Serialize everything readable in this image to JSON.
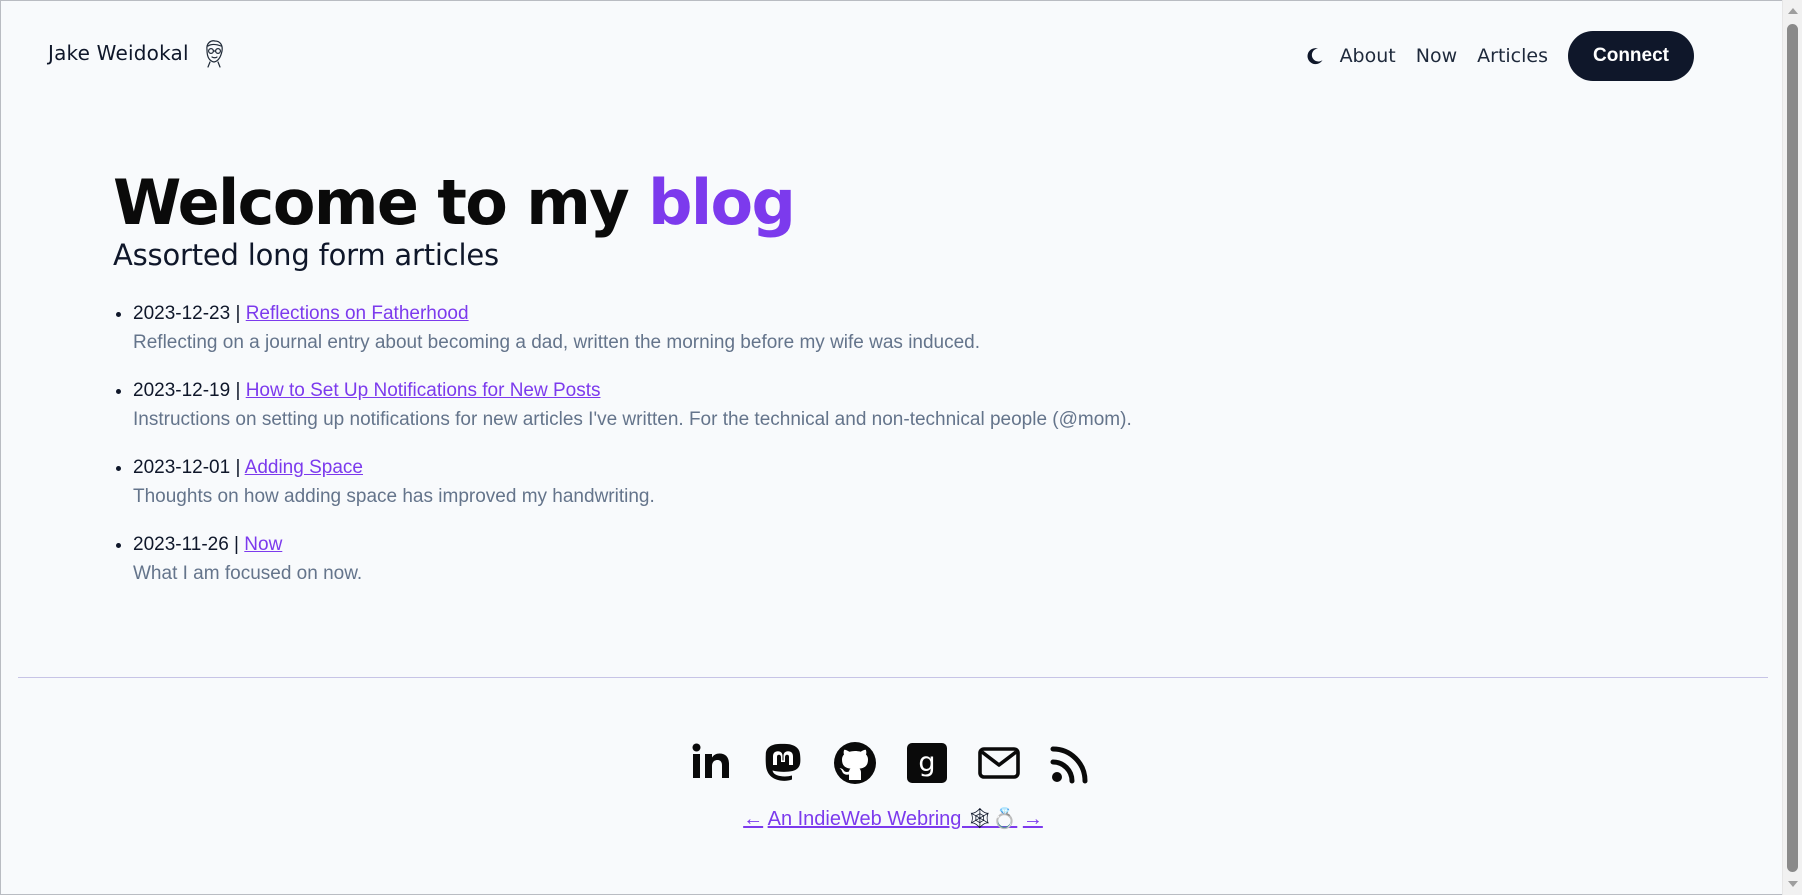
{
  "header": {
    "brand_name": "Jake Weidokal",
    "nav": {
      "about": "About",
      "now": "Now",
      "articles": "Articles",
      "connect": "Connect"
    }
  },
  "main": {
    "title_prefix": "Welcome to my ",
    "title_accent": "blog",
    "subtitle": "Assorted long form articles",
    "articles": [
      {
        "date": "2023-12-23",
        "separator": " | ",
        "title": "Reflections on Fatherhood",
        "description": "Reflecting on a journal entry about becoming a dad, written the morning before my wife was induced."
      },
      {
        "date": "2023-12-19",
        "separator": " | ",
        "title": "How to Set Up Notifications for New Posts",
        "description": "Instructions on setting up notifications for new articles I've written. For the technical and non-technical people (@mom)."
      },
      {
        "date": "2023-12-01",
        "separator": " | ",
        "title": "Adding Space",
        "description": "Thoughts on how adding space has improved my handwriting."
      },
      {
        "date": "2023-11-26",
        "separator": " | ",
        "title": "Now",
        "description": "What I am focused on now."
      }
    ]
  },
  "footer": {
    "social_icons": [
      "linkedin-icon",
      "mastodon-icon",
      "github-icon",
      "goodreads-icon",
      "email-icon",
      "rss-icon"
    ],
    "webring": {
      "prev": "←",
      "label": "An IndieWeb Webring ",
      "ring_glyph": "🕸💍",
      "next": "→"
    }
  },
  "colors": {
    "accent": "#7c3aed",
    "button_bg": "#0f172a",
    "background": "#f8fafc",
    "muted_text": "#64748b",
    "divider": "#c7c4e6"
  }
}
